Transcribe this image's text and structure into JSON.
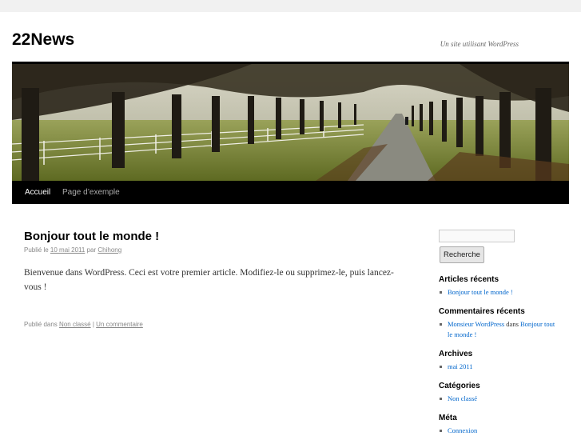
{
  "site": {
    "title": "22News",
    "description": "Un site utilisant WordPress"
  },
  "menu": {
    "items": [
      {
        "label": "Accueil",
        "current": true
      },
      {
        "label": "Page d’exemple",
        "current": false
      }
    ]
  },
  "post": {
    "title": "Bonjour tout le monde !",
    "meta_prefix": "Publié le",
    "date": "10 mai 2011",
    "by": "par",
    "author": "Chihong",
    "content": "Bienvenue dans WordPress. Ceci est votre premier article. Modifiez-le ou supprimez-le, puis lancez-vous !",
    "utility_prefix": "Publié dans",
    "category": "Non classé",
    "separator": "|",
    "comments": "Un commentaire"
  },
  "sidebar": {
    "search": {
      "value": "",
      "button_label": "Recherche"
    },
    "recent_posts": {
      "title": "Articles récents",
      "items": [
        "Bonjour tout le monde !"
      ]
    },
    "recent_comments": {
      "title": "Commentaires récents",
      "author": "Monsieur WordPress",
      "on": "dans",
      "post": "Bonjour tout le monde !"
    },
    "archives": {
      "title": "Archives",
      "items": [
        "mai 2011"
      ]
    },
    "categories": {
      "title": "Catégories",
      "items": [
        "Non classé"
      ]
    },
    "meta": {
      "title": "Méta",
      "items": [
        "Connexion"
      ]
    }
  },
  "colors": {
    "page_bg": "#f1f1f1",
    "link": "#0066cc",
    "menu_bg": "#000000"
  }
}
